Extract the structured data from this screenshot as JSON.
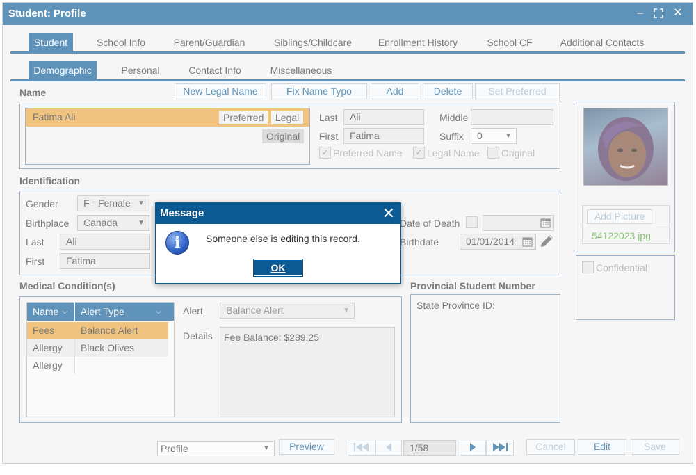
{
  "window": {
    "title": "Student: Profile",
    "controls": {
      "minimize": "–",
      "maximize": "⛶",
      "close": "✕"
    }
  },
  "main_tabs": [
    "Student",
    "School Info",
    "Parent/Guardian",
    "Siblings/Childcare",
    "Enrollment History",
    "School CF",
    "Additional Contacts"
  ],
  "sub_tabs": [
    "Demographic",
    "Personal",
    "Contact Info",
    "Miscellaneous"
  ],
  "name_section": {
    "label": "Name",
    "buttons": [
      "New Legal Name",
      "Fix Name Typo",
      "Add",
      "Delete",
      "Set Preferred"
    ],
    "selected_name": "Fatima Ali",
    "badges": {
      "preferred": "Preferred",
      "legal": "Legal",
      "original": "Original"
    },
    "last_label": "Last",
    "last_value": "Ali",
    "first_label": "First",
    "first_value": "Fatima",
    "middle_label": "Middle",
    "middle_value": "",
    "suffix_label": "Suffix",
    "suffix_value": "0",
    "checks": [
      "Preferred Name",
      "Legal Name",
      "Original"
    ]
  },
  "photo": {
    "add_picture": "Add Picture",
    "filename": "54122023 jpg"
  },
  "confidential_label": "Confidential",
  "identification": {
    "label": "Identification",
    "gender_label": "Gender",
    "gender_value": "F - Female",
    "birthplace_label": "Birthplace",
    "birthplace_value": "Canada",
    "last_label": "Last",
    "last_value": "Ali",
    "first_label": "First",
    "first_value": "Fatima",
    "date_of_death_label": "Date of Death",
    "birthdate_label": "Birthdate",
    "birthdate_value": "01/01/2014"
  },
  "medical": {
    "label": "Medical Condition(s)",
    "columns": [
      "Name",
      "Alert Type"
    ],
    "rows": [
      {
        "name": "Fees",
        "alert": "Balance Alert"
      },
      {
        "name": "Allergy",
        "alert": "Black Olives"
      },
      {
        "name": "Allergy",
        "alert": ""
      }
    ],
    "alert_label": "Alert",
    "alert_value": "Balance Alert",
    "details_label": "Details",
    "details_value": "Fee Balance: $289.25"
  },
  "provincial": {
    "label": "Provincial Student Number",
    "state_province": "State Province ID:"
  },
  "bottom_bar": {
    "profile_value": "Profile",
    "preview": "Preview",
    "page": "1/58",
    "cancel": "Cancel",
    "edit": "Edit",
    "save": "Save"
  },
  "dialog": {
    "title": "Message",
    "message": "Someone else is editing this record.",
    "ok": "OK"
  },
  "colors": {
    "primary": "#0b5a94",
    "highlight": "#e8a43a",
    "filename": "#4aaa2a"
  }
}
